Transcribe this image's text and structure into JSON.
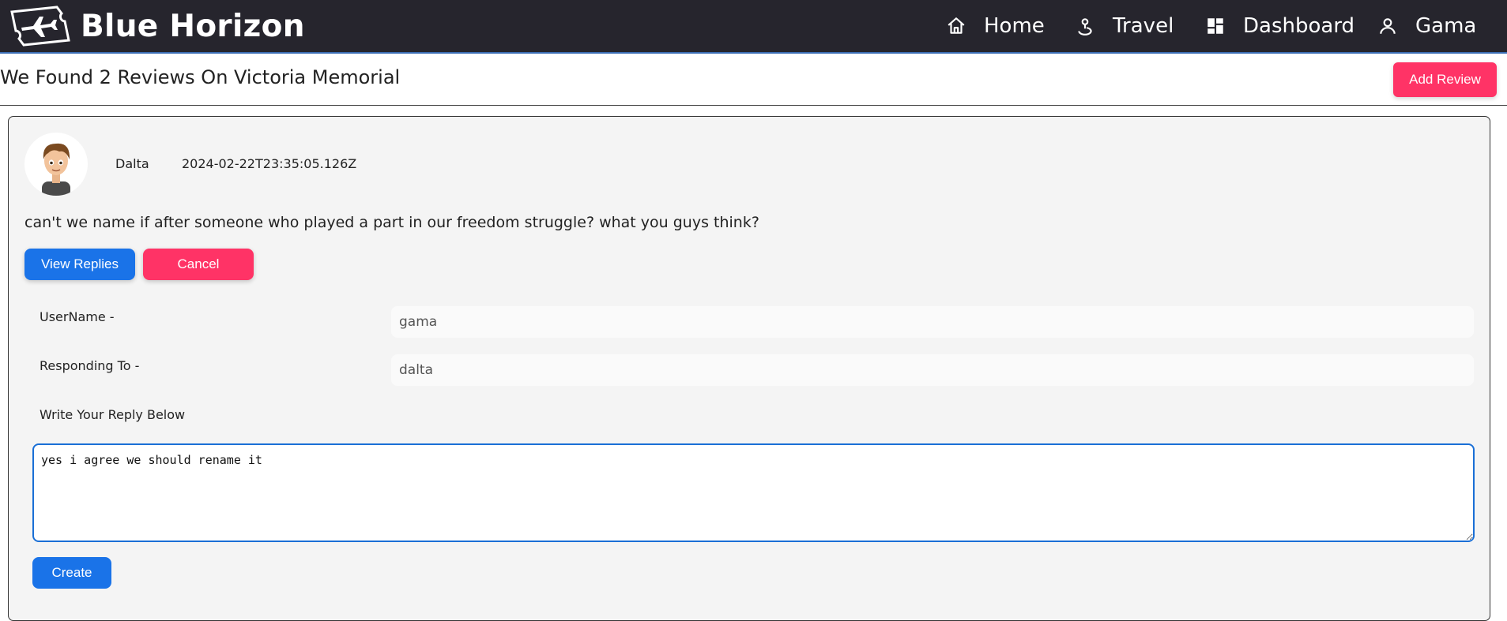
{
  "app": {
    "brand_name": "Blue Horizon",
    "nav": {
      "home": "Home",
      "travel": "Travel",
      "dashboard": "Dashboard",
      "user": "Gama"
    }
  },
  "page": {
    "title": "We Found 2 Reviews On Victoria Memorial",
    "add_review_label": "Add Review"
  },
  "review": {
    "author": "Dalta",
    "timestamp": "2024-02-22T23:35:05.126Z",
    "text": "can't we name if after someone who played a part in our freedom struggle? what you guys think?",
    "view_replies_label": "View Replies",
    "cancel_label": "Cancel"
  },
  "reply_form": {
    "username_label": "UserName -",
    "username_value": "gama",
    "responding_label": "Responding To -",
    "responding_value": "dalta",
    "write_label": "Write Your Reply Below",
    "reply_value": "yes i agree we should rename it ",
    "create_label": "Create"
  },
  "colors": {
    "navbar": "#26252d",
    "primary": "#1a73e8",
    "accent": "#ff3366",
    "card_bg": "#f4f4f4"
  },
  "icons": [
    "plane-ticket-icon",
    "home-icon",
    "travel-icon",
    "dashboard-icon",
    "user-icon"
  ]
}
